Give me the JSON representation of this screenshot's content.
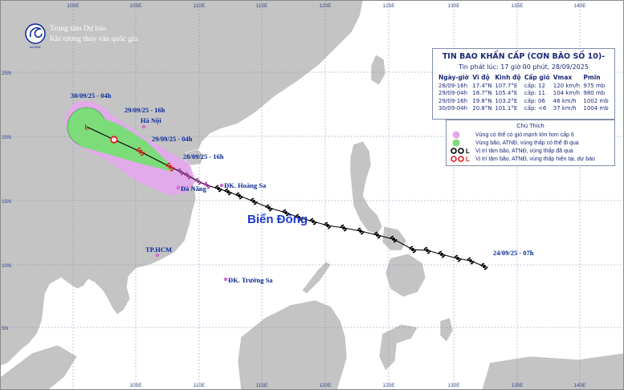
{
  "header": {
    "org_line1": "Trung tâm Dự báo",
    "org_line2": "Khí tượng thủy văn quốc gia",
    "logo_caption": "NCHMF"
  },
  "bulletin": {
    "title": "TIN BAO KHẨN CẤP (CƠN BÃO SỐ 10)-",
    "issued": "Tin phát lúc: 17 giờ 00 phút, 28/09/2025",
    "columns": [
      "Ngày-giờ",
      "Vĩ độ",
      "Kinh độ",
      "Cấp gió",
      "Vmax",
      "Pmin"
    ],
    "rows": [
      {
        "time": "28/09-16h",
        "lat": "17.4°N",
        "lon": "107.7°E",
        "level": "cấp: 12",
        "vmax": "120 km/h",
        "pmin": "975 mb"
      },
      {
        "time": "29/09-04h",
        "lat": "18.7°N",
        "lon": "105.4°E",
        "level": "cấp: 11",
        "vmax": "104 km/h",
        "pmin": "980 mb"
      },
      {
        "time": "29/09-16h",
        "lat": "19.8°N",
        "lon": "103.2°E",
        "level": "cấp: 06",
        "vmax": "46 km/h",
        "pmin": "1002 mb"
      },
      {
        "time": "30/09-04h",
        "lat": "20.8°N",
        "lon": "101.1°E",
        "level": "cấp: <6",
        "vmax": "37 km/h",
        "pmin": "1004 mb"
      }
    ]
  },
  "legend": {
    "title": "Chú Thích",
    "items": [
      {
        "text": "Vùng có thể có gió mạnh lớn hơn cấp 6",
        "color": "#e3a8ec"
      },
      {
        "text": "Vùng bão, ATNĐ, vùng thấp có thể đi qua",
        "color": "#7ddc7a"
      },
      {
        "text": "Vị trí tâm bão, ATNĐ, vùng thấp đã qua",
        "color": "#000000"
      },
      {
        "text": "Vị trí tâm bão, ATNĐ, vùng thấp hiện tại, dự báo",
        "color": "#e02020"
      }
    ]
  },
  "labels": {
    "t_30_04": "30/09/25 - 04h",
    "t_29_16": "29/09/25 - 16h",
    "t_29_04": "29/09/25 - 04h",
    "t_28_16": "28/09/25 - 16h",
    "t_24_07": "24/09/25 - 07h",
    "hanoi": "Hà Nội",
    "danang": "Đà Nẵng",
    "hcm": "TP.HCM",
    "hoangsa": "ĐK. Hoàng Sa",
    "truongsa": "ĐK. Trường Sa",
    "biendong": "Biển Đông"
  },
  "axes": {
    "top_lon": [
      "100E",
      "105E",
      "110E",
      "115E",
      "120E",
      "125E",
      "130E",
      "135E",
      "140E"
    ],
    "bottom_lon": [
      "105E",
      "110E",
      "115E",
      "120E",
      "125E",
      "130E",
      "135E",
      "140E"
    ],
    "lat": [
      "25N",
      "20N",
      "15N",
      "10N",
      "5N"
    ]
  },
  "colors": {
    "sea": "#0b2a9a",
    "land": "#c8c8c8",
    "wind_zone": "#e3a8ec",
    "track_zone": "#7ddc7a",
    "forecast": "#e02020",
    "past": "#000000",
    "label_blue": "#1a3acc"
  }
}
